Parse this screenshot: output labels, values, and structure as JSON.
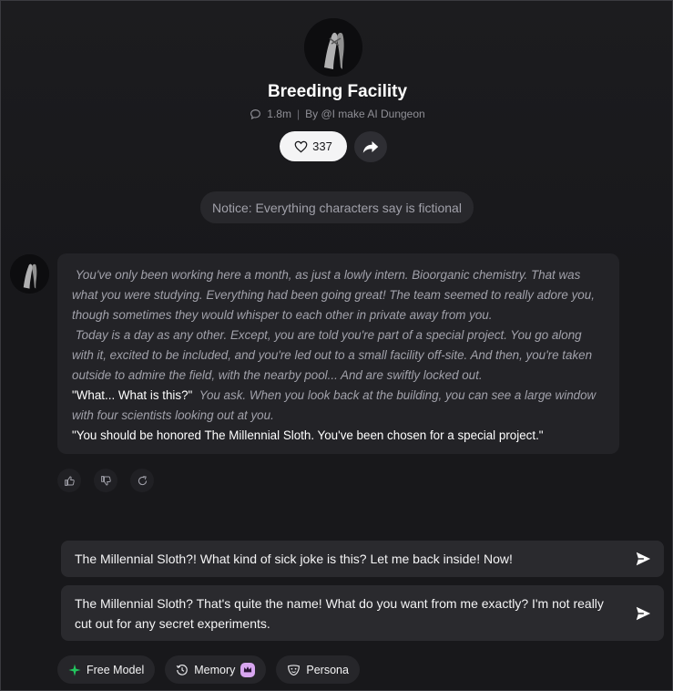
{
  "character": {
    "name": "Breeding Facility",
    "interactions": "1.8m",
    "author": "By @I make AI Dungeon",
    "likes": "337"
  },
  "notice": "Notice: Everything characters say is fictional",
  "message": {
    "p1": "You've only been working here a month, as just a lowly intern. Bioorganic chemistry. That was what you were studying. Everything had been going great! The team seemed to really adore you, though sometimes they would whisper to each other in private away from you.",
    "p2": "Today is a day as any other. Except, you are told you're part of a special project. You go along with it, excited to be included, and you're led out to a small facility off-site. And then, you're taken outside to admire the field, with the nearby pool... And are swiftly locked out.",
    "q1": "\"What... What is this?\"",
    "p3": "You ask. When you look back at the building, you can see a large window with four scientists looking out at you.",
    "q2": "\"You should be honored The Millennial Sloth. You've been chosen for a special project.\""
  },
  "suggestions": [
    "The Millennial Sloth?! What kind of sick joke is this? Let me back inside! Now!",
    "The Millennial Sloth? That's quite the name! What do you want from me exactly? I'm not really cut out for any secret experiments."
  ],
  "chips": {
    "model": "Free Model",
    "memory": "Memory",
    "persona": "Persona"
  },
  "icons": {
    "chat": "chat-bubble-icon",
    "heart": "heart-icon",
    "share": "share-arrow-icon",
    "thumbs_up": "thumbs-up-icon",
    "thumbs_down": "thumbs-down-icon",
    "regenerate": "regenerate-icon",
    "send": "send-icon",
    "sparkle": "sparkle-icon",
    "memory": "memory-clock-icon",
    "persona": "persona-mask-icon"
  },
  "colors": {
    "background": "#18181b",
    "bubble": "#232327",
    "accent_green": "#22c55e",
    "badge_purple": "#d8a6f0"
  }
}
